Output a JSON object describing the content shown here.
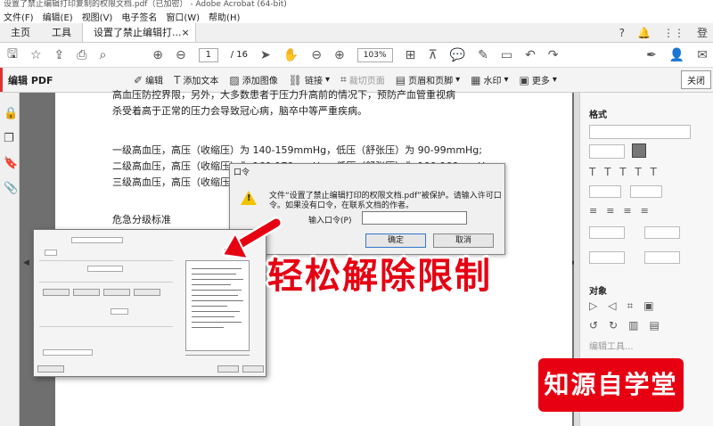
{
  "window": {
    "title": "设置了禁止编辑打印复制的权限文档.pdf（已加密） - Adobe Acrobat (64-bit)"
  },
  "menu": [
    "文件(F)",
    "编辑(E)",
    "视图(V)",
    "电子签名",
    "窗口(W)",
    "帮助(H)"
  ],
  "tabs": {
    "home": "主页",
    "tools": "工具",
    "doc": "设置了禁止编辑打...",
    "doc_close": "×",
    "login": "登"
  },
  "toolbar": {
    "page_current": "1",
    "page_total": "/ 16",
    "zoom": "103%"
  },
  "editbar": {
    "title": "编辑 PDF",
    "items": [
      "编辑",
      "添加文本",
      "添加图像",
      "链接",
      "裁切页面",
      "页眉和页脚",
      "水印",
      "更多"
    ],
    "close": "关闭"
  },
  "document": {
    "lines": [
      "高血压防控界限，另外，大多数患者于压力升高前的情况下，预防产血管重视病",
      "杀受着高于正常的压力会导致冠心病，脑卒中等严重疾病。",
      "一级高血压，高压（收缩压）为 140-159mmHg，低压（舒张压）为 90-99mmHg;",
      "二级高血压，高压（收缩压）为 160-179mmHg，低压（舒张压）为 100-109mmHg;",
      "三级高血压，高压（收缩压）为",
      "危急分级标准"
    ]
  },
  "password_dialog": {
    "title": "口令",
    "message_line1": "文件“设置了禁止编辑打印的权限文档.pdf”被保护。请输入许可口",
    "message_line2": "令。如果没有口令，在联系文档的作者。",
    "input_label": "输入口令(P)",
    "input_value": "",
    "ok": "确定",
    "cancel": "取消"
  },
  "right_panel": {
    "format": "格式",
    "objects": "对象",
    "edit_tools": "编辑工具..."
  },
  "overlay": {
    "headline": "轻松解除限制",
    "brand": "知源自学堂"
  },
  "colors": {
    "accent_red": "#e60012",
    "warning": "#f2c200"
  }
}
